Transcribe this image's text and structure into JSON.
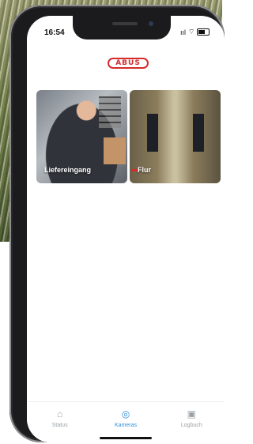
{
  "status_bar": {
    "time": "16:54",
    "signal": "ııl",
    "wifi": "⌔"
  },
  "brand": {
    "logo_text": "ABUS",
    "accent": "#d42b2b"
  },
  "cameras": [
    {
      "label": "Liefereingang"
    },
    {
      "label": "Flur"
    }
  ],
  "tabs": [
    {
      "label": "Status",
      "icon": "home-icon",
      "active": false
    },
    {
      "label": "Kameras",
      "icon": "camera-icon",
      "active": true
    },
    {
      "label": "Logbuch",
      "icon": "calendar-icon",
      "active": false
    }
  ],
  "colors": {
    "active_tab": "#2f8fd8",
    "inactive_tab": "#9aa0a6"
  }
}
